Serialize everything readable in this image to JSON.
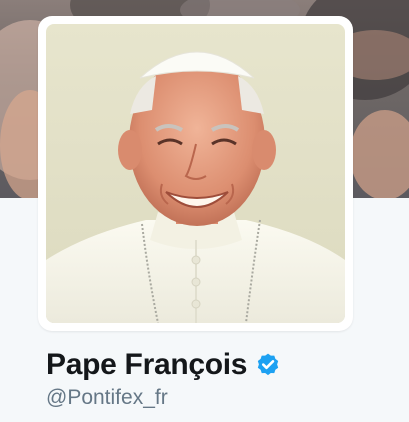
{
  "profile": {
    "display_name": "Pape François",
    "handle": "@Pontifex_fr",
    "verified": true,
    "verified_icon": "verified-badge-icon"
  },
  "colors": {
    "page_background": "#f5f8fa",
    "name_text": "#14171a",
    "handle_text": "#657786",
    "verified_blue": "#1da1f2",
    "avatar_frame": "#ffffff"
  },
  "images": {
    "banner": "blurred crowd photo header",
    "avatar": "portrait of smiling man in white cassock and white skullcap"
  }
}
